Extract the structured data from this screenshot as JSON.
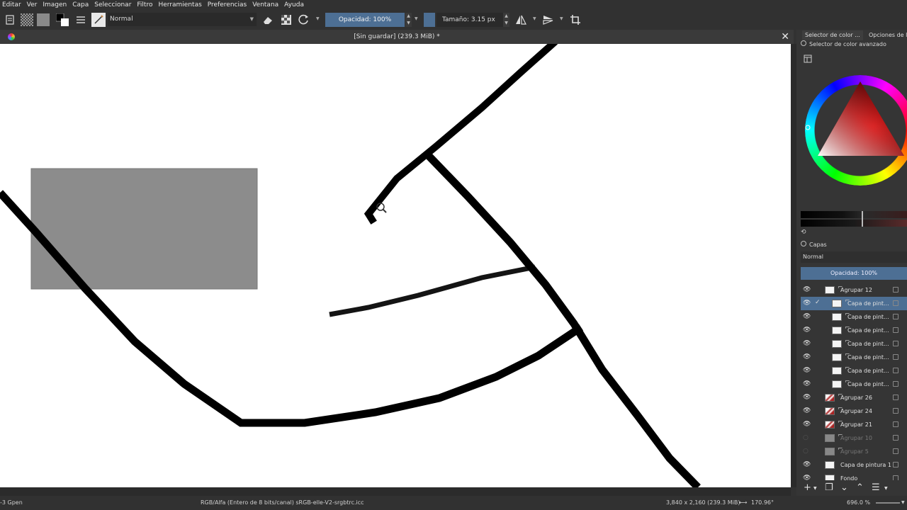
{
  "menu": [
    "Editar",
    "Ver",
    "Imagen",
    "Capa",
    "Seleccionar",
    "Filtro",
    "Herramientas",
    "Preferencias",
    "Ventana",
    "Ayuda"
  ],
  "toolbar": {
    "blend_mode": "Normal",
    "opacity_label": "Opacidad: 100%",
    "size_label": "Tamaño: 3.15 px",
    "icons": [
      "document-icon",
      "pattern-icon",
      "gray-swatch-icon",
      "color-swap-icon",
      "presets-icon",
      "brush-preset-icon",
      "eraser-icon",
      "alpha-lock-icon",
      "reload-icon",
      "mirror-horizontal-icon",
      "mirror-vertical-icon",
      "crop-icon"
    ]
  },
  "document": {
    "title": "[Sin guardar]  (239.3 MiB) *"
  },
  "dock": {
    "tab_color": "Selector de color ...",
    "tab_options": "Opciones de l",
    "color_selector_title": "Selector de color avanzado",
    "layers_title": "Capas",
    "layers_blend": "Normal",
    "layers_opacity": "Opacidad:  100%"
  },
  "layers": [
    {
      "name": "Agrupar 12",
      "visible": true,
      "selected": false,
      "group": true,
      "indent": 0,
      "dim": false,
      "thumb": "white"
    },
    {
      "name": "Capa de pint...",
      "visible": true,
      "selected": true,
      "group": false,
      "indent": 1,
      "dim": false,
      "thumb": "white",
      "checked": true
    },
    {
      "name": "Capa de pint...",
      "visible": true,
      "selected": false,
      "group": false,
      "indent": 1,
      "dim": false,
      "thumb": "white"
    },
    {
      "name": "Capa de pint...",
      "visible": true,
      "selected": false,
      "group": false,
      "indent": 1,
      "dim": false,
      "thumb": "white"
    },
    {
      "name": "Capa de pint...",
      "visible": true,
      "selected": false,
      "group": false,
      "indent": 1,
      "dim": false,
      "thumb": "white"
    },
    {
      "name": "Capa de pint...",
      "visible": true,
      "selected": false,
      "group": false,
      "indent": 1,
      "dim": false,
      "thumb": "white"
    },
    {
      "name": "Capa de pint...",
      "visible": true,
      "selected": false,
      "group": false,
      "indent": 1,
      "dim": false,
      "thumb": "white"
    },
    {
      "name": "Capa de pint...",
      "visible": true,
      "selected": false,
      "group": false,
      "indent": 1,
      "dim": false,
      "thumb": "white"
    },
    {
      "name": "Agrupar 26",
      "visible": true,
      "selected": false,
      "group": true,
      "indent": 0,
      "dim": false,
      "thumb": "red"
    },
    {
      "name": "Agrupar 24",
      "visible": true,
      "selected": false,
      "group": true,
      "indent": 0,
      "dim": false,
      "thumb": "red"
    },
    {
      "name": "Agrupar 21",
      "visible": true,
      "selected": false,
      "group": true,
      "indent": 0,
      "dim": false,
      "thumb": "red"
    },
    {
      "name": "Agrupar 10",
      "visible": false,
      "selected": false,
      "group": true,
      "indent": 0,
      "dim": true,
      "thumb": "gray"
    },
    {
      "name": "Agrupar 5",
      "visible": false,
      "selected": false,
      "group": true,
      "indent": 0,
      "dim": true,
      "thumb": "gray"
    },
    {
      "name": "Capa de pintura 1",
      "visible": true,
      "selected": false,
      "group": false,
      "indent": 0,
      "dim": false,
      "thumb": "white"
    },
    {
      "name": "Fondo",
      "visible": true,
      "selected": false,
      "group": false,
      "indent": 0,
      "dim": false,
      "thumb": "white"
    }
  ],
  "status": {
    "brush": "-3 Gpen",
    "colorspace": "RGB/Alfa (Entero de 8 bits/canal)  sRGB-elle-V2-srgbtrc.icc",
    "dimensions": "3,840 x 2,160 (239.3 MiB)",
    "rotation": "170.96°",
    "zoom": "696.0 %"
  },
  "colors": {
    "accent": "#4d6f94",
    "canvas": "#ffffff",
    "panel": "#353535",
    "gray_rect": "#8c8c8c"
  }
}
